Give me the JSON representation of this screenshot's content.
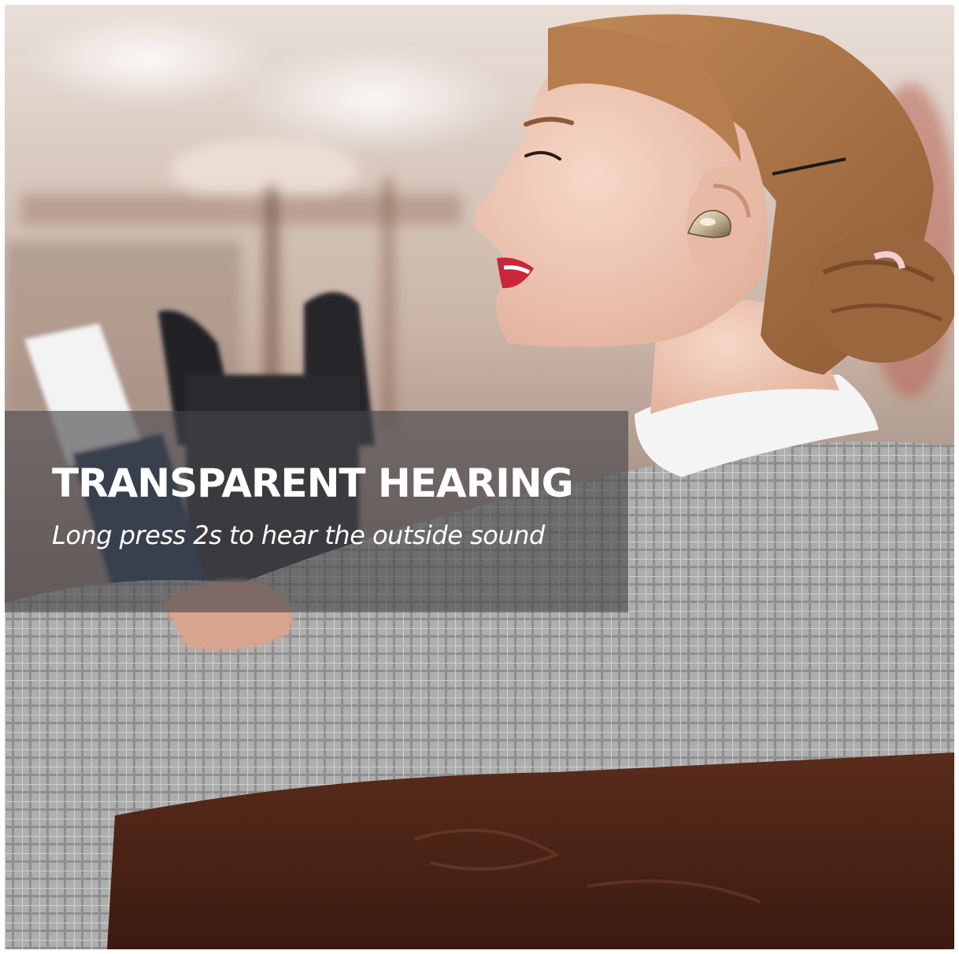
{
  "caption": {
    "title": "TRANSPARENT HEARING",
    "subtitle": "Long press 2s to hear the outside sound"
  },
  "colors": {
    "panel": "#46464a",
    "text": "#ffffff",
    "lips": "#c8283a",
    "earbud": "#c9b892",
    "hair": "#b07a4a",
    "blazer": "#9c9c9c",
    "bench": "#4a2418"
  }
}
